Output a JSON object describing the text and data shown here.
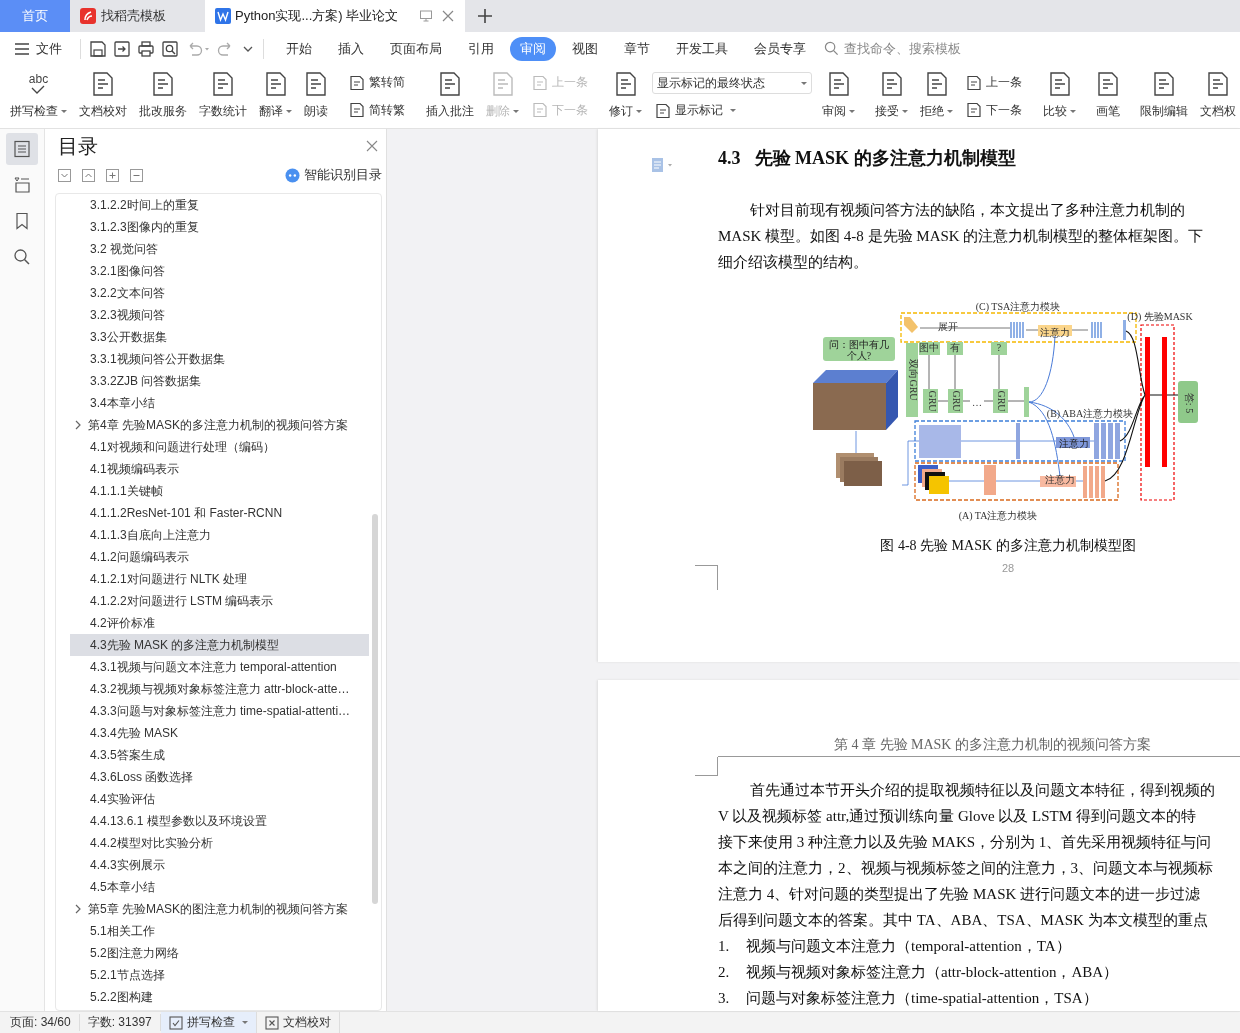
{
  "tabs": [
    {
      "label": "首页",
      "kind": "home",
      "selected": false
    },
    {
      "label": "找稻壳模板",
      "kind": "template",
      "selected": false
    },
    {
      "label": "Python实现...方案) 毕业论文",
      "kind": "doc",
      "selected": true
    }
  ],
  "menu": {
    "file_label": "文件",
    "tabs": [
      {
        "label": "开始",
        "selected": false
      },
      {
        "label": "插入",
        "selected": false
      },
      {
        "label": "页面布局",
        "selected": false
      },
      {
        "label": "引用",
        "selected": false
      },
      {
        "label": "审阅",
        "selected": true
      },
      {
        "label": "视图",
        "selected": false
      },
      {
        "label": "章节",
        "selected": false
      },
      {
        "label": "开发工具",
        "selected": false
      },
      {
        "label": "会员专享",
        "selected": false
      }
    ],
    "search_placeholder": "查找命令、搜索模板"
  },
  "ribbon_groups": [
    [
      {
        "kind": "large",
        "label": "拼写检查",
        "dropdown": true,
        "disabled": false,
        "icon_text": "abc"
      },
      {
        "kind": "large",
        "label": "文档校对",
        "dropdown": false,
        "disabled": false
      },
      {
        "kind": "large",
        "label": "批改服务",
        "dropdown": false,
        "disabled": false
      },
      {
        "kind": "large",
        "label": "字数统计",
        "dropdown": false,
        "disabled": false
      },
      {
        "kind": "large",
        "label": "翻译",
        "dropdown": true,
        "disabled": false
      },
      {
        "kind": "large",
        "label": "朗读",
        "dropdown": false,
        "disabled": false
      }
    ],
    [
      {
        "kind": "stack",
        "items": [
          {
            "label": "繁转简",
            "disabled": false
          },
          {
            "label": "简转繁",
            "disabled": false
          }
        ]
      }
    ],
    [
      {
        "kind": "large",
        "label": "插入批注",
        "dropdown": false,
        "disabled": false
      },
      {
        "kind": "large",
        "label": "删除",
        "dropdown": true,
        "disabled": true
      },
      {
        "kind": "stack",
        "items": [
          {
            "label": "上一条",
            "disabled": true
          },
          {
            "label": "下一条",
            "disabled": true
          }
        ]
      }
    ],
    [
      {
        "kind": "large",
        "label": "修订",
        "dropdown": true,
        "disabled": false
      },
      {
        "kind": "select_stack",
        "select": "显示标记的最终状态",
        "button": {
          "label": "显示标记",
          "dropdown": true
        }
      },
      {
        "kind": "large",
        "label": "审阅",
        "dropdown": true,
        "disabled": false
      }
    ],
    [
      {
        "kind": "large",
        "label": "接受",
        "dropdown": true,
        "disabled": false
      },
      {
        "kind": "large",
        "label": "拒绝",
        "dropdown": true,
        "disabled": false
      },
      {
        "kind": "stack",
        "items": [
          {
            "label": "上一条",
            "disabled": false
          },
          {
            "label": "下一条",
            "disabled": false
          }
        ]
      }
    ],
    [
      {
        "kind": "large",
        "label": "比较",
        "dropdown": true,
        "disabled": false
      }
    ],
    [
      {
        "kind": "large",
        "label": "画笔",
        "dropdown": false,
        "disabled": false
      }
    ],
    [
      {
        "kind": "large",
        "label": "限制编辑",
        "dropdown": false,
        "disabled": false
      },
      {
        "kind": "large",
        "label": "文档权",
        "dropdown": false,
        "disabled": false
      }
    ]
  ],
  "side_tools": [
    {
      "selected": true
    },
    {
      "selected": false
    },
    {
      "selected": false
    },
    {
      "selected": false
    }
  ],
  "toc": {
    "title": "目录",
    "smart_label": "智能识别目录",
    "items": [
      {
        "kind": "section",
        "label": "3.1.2.2时间上的重复",
        "selected": false
      },
      {
        "kind": "section",
        "label": "3.1.2.3图像内的重复",
        "selected": false
      },
      {
        "kind": "section",
        "label": "3.2  视觉问答",
        "selected": false
      },
      {
        "kind": "section",
        "label": "3.2.1图像问答",
        "selected": false
      },
      {
        "kind": "section",
        "label": "3.2.2文本问答",
        "selected": false
      },
      {
        "kind": "section",
        "label": "3.2.3视频问答",
        "selected": false
      },
      {
        "kind": "section",
        "label": "3.3公开数据集",
        "selected": false
      },
      {
        "kind": "section",
        "label": "3.3.1视频问答公开数据集",
        "selected": false
      },
      {
        "kind": "section",
        "label": "3.3.2ZJB 问答数据集",
        "selected": false
      },
      {
        "kind": "section",
        "label": "3.4本章小结",
        "selected": false
      },
      {
        "kind": "chapter",
        "label": "第4章  先验MASK的多注意力机制的视频问答方案",
        "selected": false,
        "children": [
          {
            "label": "4.1对视频和问题进行处理（编码）",
            "selected": false
          },
          {
            "label": "4.1视频编码表示",
            "selected": false
          },
          {
            "label": "4.1.1.1关键帧",
            "selected": false
          },
          {
            "label": "4.1.1.2ResNet-101 和 Faster-RCNN",
            "selected": false
          },
          {
            "label": "4.1.1.3自底向上注意力",
            "selected": false
          },
          {
            "label": "4.1.2问题编码表示",
            "selected": false
          },
          {
            "label": "4.1.2.1对问题进行 NLTK 处理",
            "selected": false
          },
          {
            "label": "4.1.2.2对问题进行 LSTM 编码表示",
            "selected": false
          },
          {
            "label": "4.2评价标准",
            "selected": false
          },
          {
            "label": "4.3先验 MASK 的多注意力机制模型",
            "selected": true
          },
          {
            "label": "4.3.1视频与问题文本注意力 temporal-attention",
            "selected": false
          },
          {
            "label": "4.3.2视频与视频对象标签注意力 attr-block-atte…",
            "selected": false
          },
          {
            "label": "4.3.3问题与对象标签注意力 time-spatial-attenti…",
            "selected": false
          },
          {
            "label": "4.3.4先验 MASK",
            "selected": false
          },
          {
            "label": "4.3.5答案生成",
            "selected": false
          },
          {
            "label": "4.3.6Loss 函数选择",
            "selected": false
          },
          {
            "label": "4.4实验评估",
            "selected": false
          },
          {
            "label": "4.4.13.6.1 模型参数以及环境设置",
            "selected": false
          },
          {
            "label": "4.4.2模型对比实验分析",
            "selected": false
          },
          {
            "label": "4.4.3实例展示",
            "selected": false
          },
          {
            "label": "4.5本章小结",
            "selected": false
          }
        ]
      },
      {
        "kind": "chapter",
        "label": "第5章  先验MASK的图注意力机制的视频问答方案",
        "selected": false,
        "children": [
          {
            "label": "5.1相关工作",
            "selected": false
          },
          {
            "label": "5.2图注意力网络",
            "selected": false
          },
          {
            "label": "5.2.1节点选择",
            "selected": false
          },
          {
            "label": "5.2.2图构建",
            "selected": false
          }
        ]
      }
    ]
  },
  "document": {
    "page1": {
      "heading_number": "4.3",
      "heading_title": "先验 MASK 的多注意力机制模型",
      "paragraph": [
        "针对目前现有视频问答方法的缺陷，本文提出了多种注意力机制的",
        "MASK 模型。如图 4-8 是先验 MASK 的注意力机制模型的整体框架图。下",
        "细介绍该模型的结构。"
      ],
      "figure_labels": [
        "(C)  TSA注意力模块",
        "(D)  先验MASK",
        "问：图中有几",
        "个人?",
        "展开",
        "注意力",
        "双向GRU",
        "图中",
        "有",
        "?",
        "GRU",
        "GRU",
        "…",
        "GRU",
        "(B)  ABA注意力模块",
        "注意力",
        "注意力",
        "(A)  TA注意力模块",
        "答: 5"
      ],
      "caption": "图 4-8 先验 MASK 的多注意力机制模型图",
      "page_number": "28"
    },
    "page2": {
      "running_header": "第 4 章  先验 MASK 的多注意力机制的视频问答方案",
      "paragraph": [
        "首先通过本节开头介绍的提取视频特征以及问题文本特征，得到视频的",
        "V 以及视频标签 attr,通过预训练向量 Glove 以及 LSTM 得到问题文本的特",
        "接下来使用 3 种注意力以及先验 MAKS，分别为 1、首先采用视频特征与问",
        "本之间的注意力，2、视频与视频标签之间的注意力，3、问题文本与视频标",
        "注意力 4、针对问题的类型提出了先验 MASK 进行问题文本的进一步过滤",
        "后得到问题文本的答案。其中 TA、ABA、TSA、MASK 为本文模型的重点"
      ],
      "list": [
        {
          "number": "1.",
          "text": "视频与问题文本注意力（temporal-attention，TA）"
        },
        {
          "number": "2.",
          "text": "视频与视频对象标签注意力（attr-block-attention，ABA）"
        },
        {
          "number": "3.",
          "text": "问题与对象标签注意力（time-spatial-attention，TSA）"
        }
      ]
    }
  },
  "status_bar": [
    {
      "kind": "text",
      "label": "页面: 34/60"
    },
    {
      "kind": "text",
      "label": "字数: 31397"
    },
    {
      "kind": "button",
      "label": "拼写检查",
      "dropdown": true
    },
    {
      "kind": "button",
      "label": "文档校对",
      "dropdown": false
    }
  ]
}
